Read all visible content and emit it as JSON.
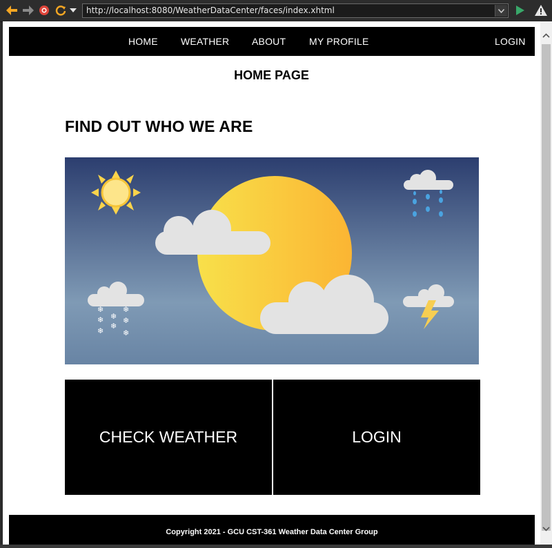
{
  "browser": {
    "url": "http://localhost:8080/WeatherDataCenter/faces/index.xhtml",
    "icons": [
      "back-arrow-icon",
      "forward-arrow-icon",
      "stop-icon",
      "refresh-icon",
      "dropdown-icon",
      "go-icon",
      "warning-icon"
    ],
    "colors": {
      "back": "#f5a623",
      "stop": "#e0453a",
      "refresh": "#f5a623",
      "go": "#39a86a"
    }
  },
  "nav": {
    "items": [
      {
        "label": "HOME"
      },
      {
        "label": "WEATHER"
      },
      {
        "label": "ABOUT"
      },
      {
        "label": "MY PROFILE"
      }
    ],
    "login_label": "LOGIN"
  },
  "page": {
    "heading": "HOME PAGE",
    "section_title": "FIND OUT WHO WE ARE"
  },
  "hero": {
    "icons": [
      "sun-icon",
      "cloud-icon",
      "rain-cloud-icon",
      "snow-cloud-icon",
      "storm-cloud-icon"
    ],
    "colors": {
      "sky_top": "#2c3e6f",
      "sky_bottom": "#7f9ab5",
      "sun": "#fbd44b",
      "cloud": "#e3e3e3",
      "rain": "#4aa3e0"
    }
  },
  "tiles": {
    "check_weather": "CHECK WEATHER",
    "login": "LOGIN"
  },
  "footer": {
    "text": "Copyright 2021 - GCU CST-361 Weather Data Center Group"
  }
}
